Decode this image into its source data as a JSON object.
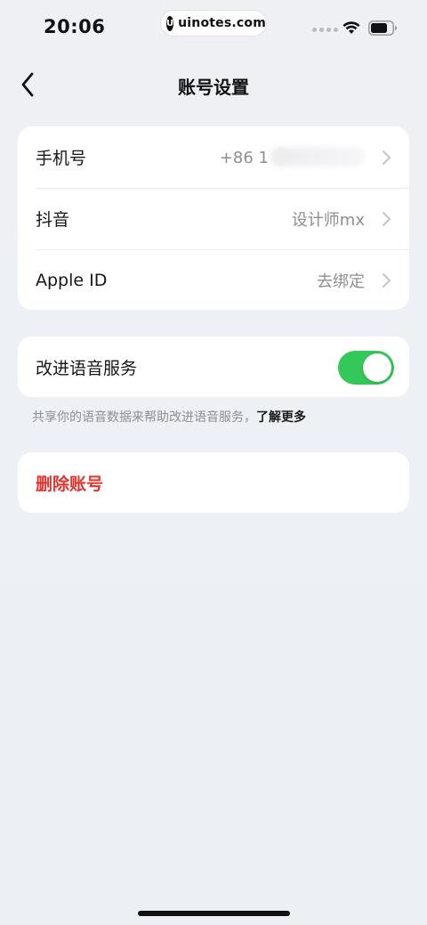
{
  "status_bar": {
    "time": "20:06",
    "watermark_logo": "U",
    "watermark_text": "uinotes.com",
    "icons": [
      "signal-dots-icon",
      "wifi-icon",
      "battery-icon"
    ]
  },
  "nav": {
    "title": "账号设置",
    "back_icon": "chevron-left-icon"
  },
  "account_rows": [
    {
      "label": "手机号",
      "value": "+86 1",
      "value_obscured": true
    },
    {
      "label": "抖音",
      "value": "设计师mx"
    },
    {
      "label": "Apple ID",
      "value": "去绑定"
    }
  ],
  "voice": {
    "label": "改进语音服务",
    "enabled": true,
    "hint_text": "共享你的语音数据来帮助改进语音服务，",
    "hint_link": "了解更多"
  },
  "delete": {
    "label": "删除账号"
  },
  "colors": {
    "toggle_on": "#34c759",
    "danger": "#e5322d",
    "secondary_text": "#8e8e93",
    "background": "#eef0f4"
  }
}
